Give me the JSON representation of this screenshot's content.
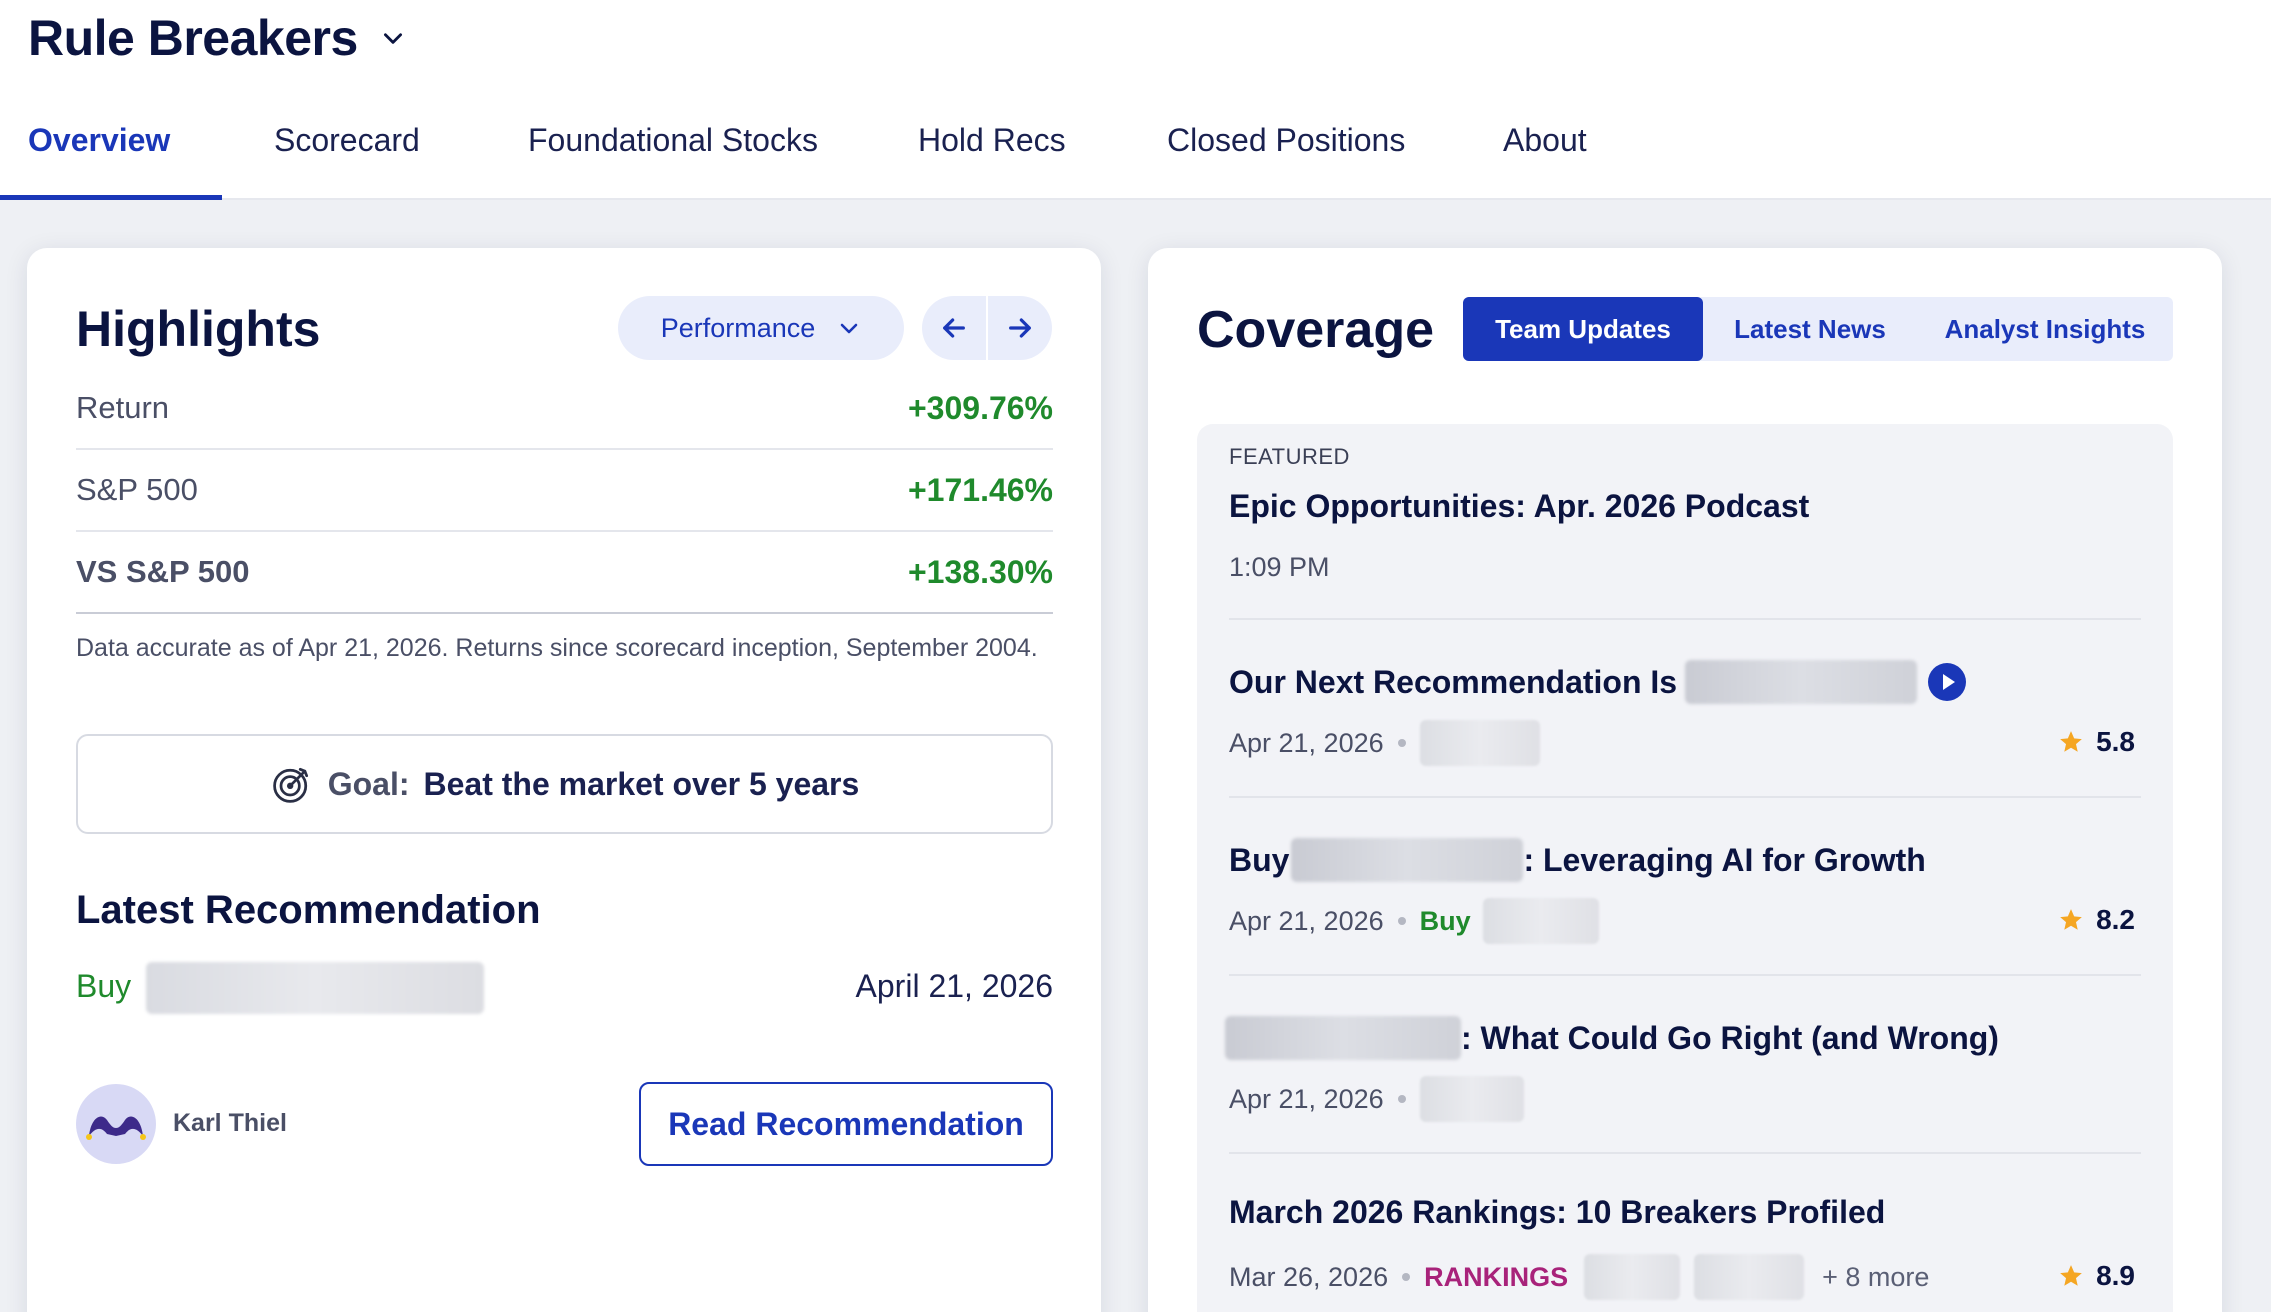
{
  "header": {
    "brand_title": "Rule Breakers",
    "brand_caret_icon": "chevron-down-icon",
    "nav": {
      "tabs": [
        {
          "label": "Overview",
          "active": true
        },
        {
          "label": "Scorecard",
          "active": false
        },
        {
          "label": "Foundational Stocks",
          "active": false
        },
        {
          "label": "Hold Recs",
          "active": false
        },
        {
          "label": "Closed Positions",
          "active": false
        },
        {
          "label": "About",
          "active": false
        }
      ]
    }
  },
  "highlights": {
    "title": "Highlights",
    "dropdown_label": "Performance",
    "dropdown_icon": "chevron-down-icon",
    "prev_icon": "arrow-left-icon",
    "next_icon": "arrow-right-icon",
    "stats": [
      {
        "label": "Return",
        "value": "+309.76%"
      },
      {
        "label": "S&P 500",
        "value": "+171.46%"
      },
      {
        "label": "VS S&P 500",
        "value": "+138.30%"
      }
    ],
    "note": "Data accurate as of Apr 21, 2026. Returns since scorecard inception, September 2004.",
    "goal": {
      "icon": "target-icon",
      "label": "Goal:",
      "text": "Beat the market over 5 years"
    },
    "latest_recommendation": {
      "title": "Latest Recommendation",
      "action": "Buy",
      "date": "April 21, 2026",
      "author": "Karl Thiel",
      "button_label": "Read Recommendation"
    }
  },
  "coverage": {
    "title": "Coverage",
    "tabs": [
      {
        "label": "Team Updates",
        "active": true
      },
      {
        "label": "Latest News",
        "active": false
      },
      {
        "label": "Analyst Insights",
        "active": false
      }
    ],
    "featured": {
      "tag": "FEATURED",
      "title": "Epic Opportunities: Apr. 2026 Podcast",
      "time": "1:09 PM"
    },
    "items": [
      {
        "title_prefix": "Our Next Recommendation Is",
        "date": "Apr 21, 2026",
        "rating": "5.8",
        "icon": "play-icon"
      },
      {
        "title_prefix": "Buy",
        "title_suffix": ": Leveraging AI for Growth",
        "date": "Apr 21, 2026",
        "tag": "Buy",
        "rating": "8.2"
      },
      {
        "title_suffix": ": What Could Go Right (and Wrong)",
        "date": "Apr 21, 2026"
      },
      {
        "title": "March 2026 Rankings: 10 Breakers Profiled",
        "date": "Mar 26, 2026",
        "tag": "RANKINGS",
        "more": "+ 8 more",
        "rating": "8.9"
      }
    ],
    "star_icon": "star-icon",
    "colors": {
      "accent": "#1a37b8",
      "positive": "#1f8a2c",
      "rankings": "#a8227a",
      "star": "#f5a623"
    }
  }
}
